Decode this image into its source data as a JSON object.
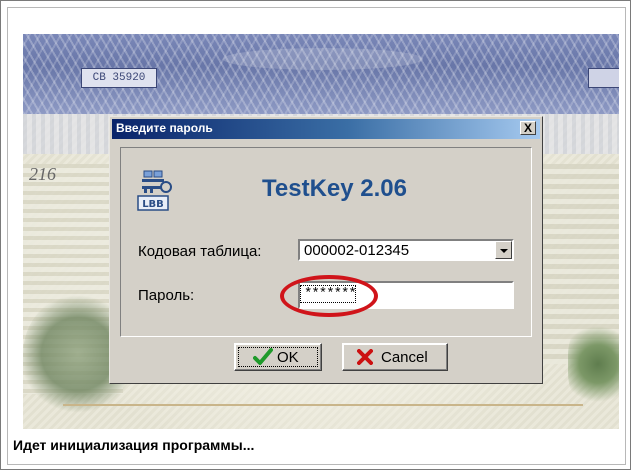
{
  "certificate": {
    "serial": "CB 35920",
    "side_number": "216"
  },
  "dialog": {
    "title": "Введите пароль",
    "close_label": "X",
    "app_name": "TestKey 2.06",
    "icon_label": "LBB",
    "code_table_label": "Кодовая таблица:",
    "code_table_value": "000002-012345",
    "password_label": "Пароль:",
    "password_value": "*******",
    "ok_label": "OK",
    "cancel_label": "Cancel"
  },
  "status": {
    "text": "Идет инициализация программы..."
  },
  "colors": {
    "title_gradient_start": "#0a246a",
    "title_gradient_end": "#a6caf0",
    "app_title": "#1f4f8e",
    "highlight_circle": "#d0141a",
    "ok_check": "#1f9a2b",
    "cancel_cross": "#cc1010"
  }
}
